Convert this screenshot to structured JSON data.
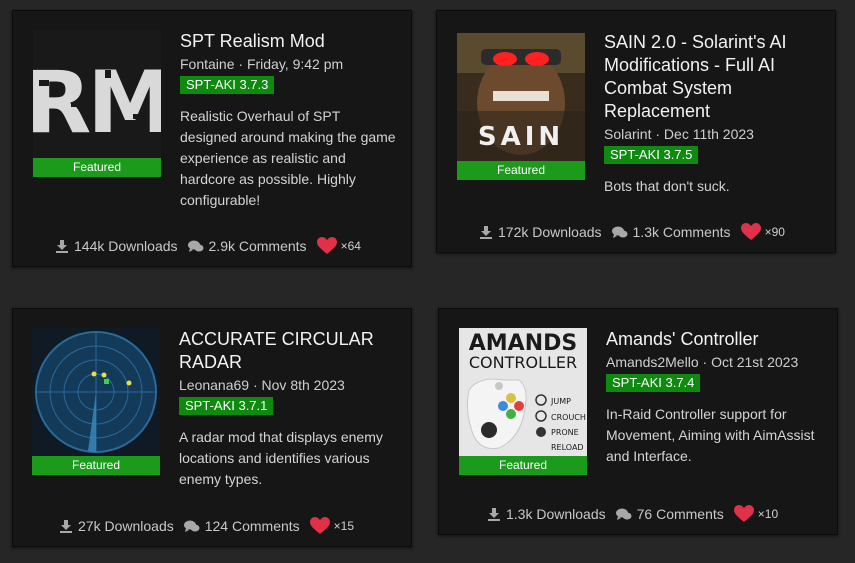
{
  "mods": [
    {
      "title": "SPT Realism Mod",
      "author": "Fontaine",
      "date": "Friday, 9:42 pm",
      "version": "SPT-AKI 3.7.3",
      "badge": "Featured",
      "thumb_text": "RM",
      "description": "Realistic Overhaul of SPT designed around making the game experience as realistic and hardcore as possible. Highly configurable!",
      "downloads": "144k Downloads",
      "comments": "2.9k Comments",
      "likes": "×64"
    },
    {
      "title": "SAIN 2.0 - Solarint's AI Modifications - Full AI Combat System Replacement",
      "author": "Solarint",
      "date": "Dec 11th 2023",
      "version": "SPT-AKI 3.7.5",
      "badge": "Featured",
      "thumb_text": "SAIN",
      "description": "Bots that don't suck.",
      "downloads": "172k Downloads",
      "comments": "1.3k Comments",
      "likes": "×90"
    },
    {
      "title": "ACCURATE CIRCULAR RADAR",
      "author": "Leonana69",
      "date": "Nov 8th 2023",
      "version": "SPT-AKI 3.7.1",
      "badge": "Featured",
      "description": "A radar mod that displays enemy locations and identifies various enemy types.",
      "downloads": "27k Downloads",
      "comments": "124 Comments",
      "likes": "×15"
    },
    {
      "title": "Amands' Controller",
      "author": "Amands2Mello",
      "date": "Oct 21st 2023",
      "version": "SPT-AKI 3.7.4",
      "badge": "Featured",
      "thumb_text_1": "AMANDS",
      "thumb_text_2": "CONTROLLER",
      "thumb_labels": [
        "JUMP",
        "CROUCH",
        "PRONE",
        "RELOAD"
      ],
      "description": "In-Raid Controller support for Movement, Aiming with AimAssist and Interface.",
      "downloads": "1.3k Downloads",
      "comments": "76 Comments",
      "likes": "×10"
    }
  ],
  "colors": {
    "featured": "#1c9a1c",
    "version": "#0e8a0e",
    "heart": "#e0304a"
  }
}
